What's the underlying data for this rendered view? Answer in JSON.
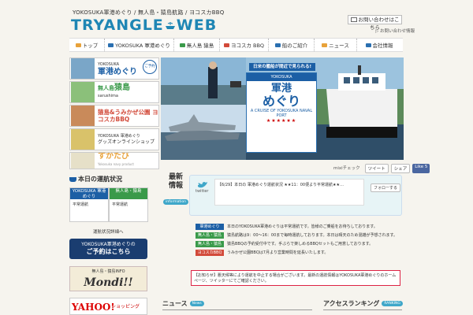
{
  "header": {
    "tagline": "YOKOSUKA軍港めぐり / 無人島・猿島航路 / ヨコスカBBQ",
    "logo_left": "TRYANGLE",
    "logo_right": "WEB",
    "contact_label": "お問い合わせはこちら",
    "small_link": "▷ お問い合わせ情報"
  },
  "nav": [
    {
      "label": "トップ",
      "icon": "home-icon",
      "color": "#e8a23a"
    },
    {
      "label": "YOKOSUKA 軍港めぐり",
      "icon": "ship-icon",
      "color": "#2a6fb0"
    },
    {
      "label": "無人島 猿島",
      "icon": "island-icon",
      "color": "#3a9a4a"
    },
    {
      "label": "ヨコスカ BBQ",
      "icon": "bbq-icon",
      "color": "#d24a3a"
    },
    {
      "label": "船のご紹介",
      "icon": "boat-icon",
      "color": "#2a6fb0"
    },
    {
      "label": "ニュース",
      "icon": "news-icon",
      "color": "#e8a23a"
    },
    {
      "label": "会社情報",
      "icon": "company-icon",
      "color": "#2a6fb0"
    }
  ],
  "sidebar": {
    "banners": [
      {
        "small": "YOKOSUKA",
        "big": "軍港めぐり",
        "color": "#1c5fa5",
        "thumb": "#7aa6c8",
        "badge": "ご予約"
      },
      {
        "small": "無人島",
        "big": "猿島",
        "sub": "sarushima",
        "color": "#3a9a4a",
        "thumb": "#8bc07a"
      },
      {
        "small": "",
        "big": "猿島&うみかぜ公園 ヨコスカBBQ",
        "color": "#d24a3a",
        "thumb": "#c98a5a"
      },
      {
        "small": "YOKOSUKA 軍港めぐり",
        "big": "グッズオンラインショップ",
        "color": "#333",
        "thumb": "#d9c26a"
      },
      {
        "small": "Yokosuka navy product",
        "big": "すかたび",
        "color": "#e8a23a",
        "thumb": "#e6e0c8"
      }
    ],
    "status_title": "本日の運航状況",
    "status": [
      {
        "head": "YOKOSUKA 軍港めぐり",
        "color": "#1c5fa5",
        "value": "平常運航"
      },
      {
        "head": "無人島・猿島",
        "color": "#3a9a4a",
        "value": "平常運航"
      }
    ],
    "status_link": "運航状況詳細へ",
    "reserve_small": "YOKOSUKA軍港めぐりの",
    "reserve_big": "ご予約はこちら",
    "mondi_small": "無人島・猿島INFO",
    "mondi_big": "Mondi!!",
    "yahoo_logo": "YAHOO!",
    "yahoo_sub": "JAPAN",
    "yahoo_shop": "ショッピング"
  },
  "hero": {
    "caption": "日米の艦船が間近で見られる!",
    "poster_top": "YOKOSUKA",
    "poster_title": "軍港",
    "poster_big": "めぐり",
    "poster_sub": "A CRUISE OF YOKOSUKA NAVAL PORT",
    "poster_stars": "★★★★★★",
    "badge": "ご予約"
  },
  "social": {
    "mixi": "mixiチェック",
    "tweet": "ツイート",
    "share": "シェア",
    "like": "Like 5"
  },
  "latest": {
    "title1": "最新",
    "title2": "情報",
    "badge": "information",
    "tweet_user": "twitter",
    "tweet_text": "【6/29】本日の 軍港めぐり運航状況 ★★11：00便より平常運航★★… ",
    "follow": "フォローする"
  },
  "news_items": [
    {
      "tag": "軍港めぐり",
      "color": "#1c5fa5",
      "text": "本日のYOKOSUKA軍港めぐりは平常運航です。皆様のご乗船をお待ちしております。"
    },
    {
      "tag": "無人島・猿島",
      "color": "#3a9a4a",
      "text": "猿島航路は9：00～16：00まで毎時運航しております。本日は晴天のため混雑が予想されます。"
    },
    {
      "tag": "無人島・猿島",
      "color": "#3a9a4a",
      "text": "猿島BBQの予約受付中です。手ぶらで楽しめるBBQセットもご用意しております。"
    },
    {
      "tag": "ヨコスカBBQ",
      "color": "#d24a3a",
      "text": "うみかぜ公園BBQは7月より営業時間を延長いたします。"
    }
  ],
  "notice": "【お知らせ】悪天候等により運航を中止する場合がございます。最新の運航情報はYOKOSUKA軍港めぐりのホームページ、ツイッターにてご確認ください。",
  "sections": {
    "news": "ニュース",
    "news_badge": "News",
    "rank": "アクセスランキング",
    "rank_badge": "RANKING"
  }
}
